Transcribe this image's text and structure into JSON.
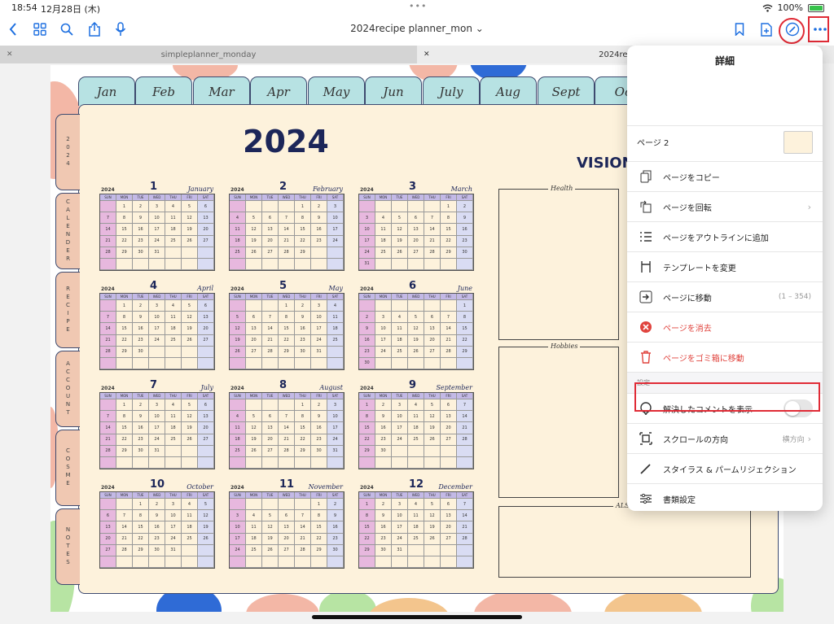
{
  "status": {
    "time": "18:54",
    "date": "12月28日 (木)",
    "battery": "100%"
  },
  "toolbar": {
    "doc_title": "2024recipe planner_mon"
  },
  "tabs": [
    {
      "label": "simpleplanner_monday"
    },
    {
      "label": "2024recipe p"
    }
  ],
  "planner": {
    "year_title": "2024",
    "vision_title": "VISION",
    "month_tabs": [
      "Jan",
      "Feb",
      "Mar",
      "Apr",
      "May",
      "Jun",
      "July",
      "Aug",
      "Sept",
      "Oc"
    ],
    "side_tabs": [
      "2024",
      "CALENDER",
      "RECIPE",
      "ACCOUNT",
      "COSME",
      "NOTES"
    ],
    "vision_boxes": [
      "Health",
      "Hobbies",
      "ALSO"
    ],
    "weekdays": [
      "SUN",
      "MON",
      "TUE",
      "WED",
      "THU",
      "FRI",
      "SAT"
    ],
    "calendars": [
      {
        "year": "2024",
        "num": "1",
        "name": "January",
        "offset": 1,
        "days": 31
      },
      {
        "year": "2024",
        "num": "2",
        "name": "February",
        "offset": 4,
        "days": 29
      },
      {
        "year": "2024",
        "num": "3",
        "name": "March",
        "offset": 5,
        "days": 31
      },
      {
        "year": "2024",
        "num": "4",
        "name": "April",
        "offset": 1,
        "days": 30
      },
      {
        "year": "2024",
        "num": "5",
        "name": "May",
        "offset": 3,
        "days": 31
      },
      {
        "year": "2024",
        "num": "6",
        "name": "June",
        "offset": 6,
        "days": 30
      },
      {
        "year": "2024",
        "num": "7",
        "name": "July",
        "offset": 1,
        "days": 31
      },
      {
        "year": "2024",
        "num": "8",
        "name": "August",
        "offset": 4,
        "days": 31
      },
      {
        "year": "2024",
        "num": "9",
        "name": "September",
        "offset": 0,
        "days": 30
      },
      {
        "year": "2024",
        "num": "10",
        "name": "October",
        "offset": 2,
        "days": 31
      },
      {
        "year": "2024",
        "num": "11",
        "name": "November",
        "offset": 5,
        "days": 30
      },
      {
        "year": "2024",
        "num": "12",
        "name": "December",
        "offset": 0,
        "days": 31
      }
    ]
  },
  "popover": {
    "title": "詳細",
    "page_label": "ページ 2",
    "items": {
      "copy": "ページをコピー",
      "rotate": "ページを回転",
      "outline": "ページをアウトラインに追加",
      "template": "テンプレートを変更",
      "goto": "ページに移動",
      "goto_range": "(1 – 354)",
      "delete": "ページを消去",
      "trash": "ページをゴミ箱に移動"
    },
    "settings_label": "設定",
    "settings": {
      "comments": "解決したコメントを表示",
      "scroll": "スクロールの方向",
      "scroll_value": "横方向",
      "stylus": "スタイラス & パームリジェクション",
      "doc_settings": "書類設定"
    }
  },
  "colors": {
    "accent": "#1d6fe0",
    "danger": "#e0443e",
    "highlight": "#e02b36",
    "tab_teal": "#b7e2e3",
    "side_tab": "#f0c8b2",
    "cream": "#fdf2dc",
    "navy": "#1c2659"
  }
}
